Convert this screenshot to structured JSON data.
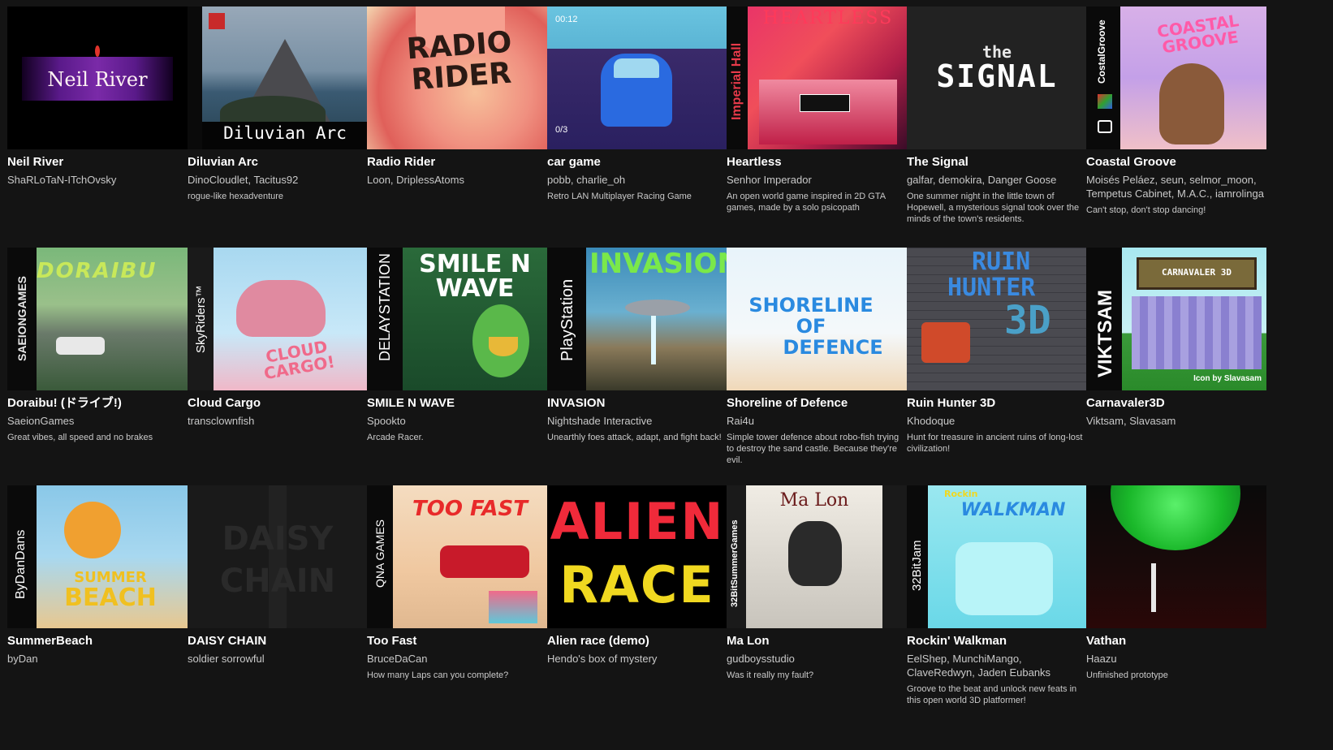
{
  "games": [
    {
      "title": "Neil River",
      "authors": [
        "ShaRLoTaN-ITchOvsky"
      ],
      "description": "",
      "cover_text": "Neil River"
    },
    {
      "title": "Diluvian Arc",
      "authors": [
        "DinoCloudlet",
        "Tacitus92"
      ],
      "description": "rogue-like hexadventure",
      "cover_text": "Diluvian Arc"
    },
    {
      "title": "Radio Rider",
      "authors": [
        "Loon",
        "DriplessAtoms"
      ],
      "description": "",
      "cover_text": "RADIO RIDER"
    },
    {
      "title": "car game",
      "authors": [
        "pobb",
        "charlie_oh"
      ],
      "description": "Retro LAN Multiplayer Racing Game",
      "video_time": "00:12",
      "video_count": "0/3"
    },
    {
      "title": "Heartless",
      "authors": [
        "Senhor Imperador"
      ],
      "description": "An open world game inspired in 2D GTA games, made by a solo psicopath",
      "cover_text": "HEARTLESS",
      "spine_text": "Imperial Hall"
    },
    {
      "title": "The Signal",
      "authors": [
        "galfar",
        "demokira",
        "Danger Goose"
      ],
      "description": "One summer night in the little town of Hopewell, a mysterious signal took over the minds of the town's residents.",
      "cover_text_small": "the",
      "cover_text": "SIGNAL"
    },
    {
      "title": "Coastal Groove",
      "authors": [
        "Moisés Peláez",
        "seun",
        "selmor_moon",
        "Tempetus Cabinet",
        "M.A.C.",
        "iamrolinga"
      ],
      "description": "Can't stop, don't stop dancing!",
      "cover_text": "COASTAL GROOVE",
      "spine_text": "CostalGroove"
    },
    {
      "title": "Doraibu! (ドライブ!)",
      "authors": [
        "SaeionGames"
      ],
      "description": "Great vibes, all speed and no brakes",
      "cover_text": "DORAIBU",
      "spine_text": "SAEIONGAMES"
    },
    {
      "title": "Cloud Cargo",
      "authors": [
        "transclownfish"
      ],
      "description": "",
      "cover_text": "CLOUD CARGO!",
      "spine_text": "SkyRiders™"
    },
    {
      "title": "SMILE N WAVE",
      "authors": [
        "Spookto"
      ],
      "description": "Arcade Racer.",
      "cover_text": "SMILE N WAVE",
      "spine_text": "DELAYSTATION"
    },
    {
      "title": "INVASION",
      "authors": [
        "Nightshade Interactive"
      ],
      "description": "Unearthly foes attack, adapt, and fight back!",
      "cover_text": "INVASION",
      "spine_text": "PlayStation"
    },
    {
      "title": "Shoreline of Defence",
      "authors": [
        "Rai4u"
      ],
      "description": "Simple tower defence about robo-fish trying to destroy the sand castle. Because they're evil.",
      "cover_lines": [
        "SHORELINE",
        "OF",
        "DEFENCE"
      ]
    },
    {
      "title": "Ruin Hunter 3D",
      "authors": [
        "Khodoque"
      ],
      "description": "Hunt for treasure in ancient ruins of long-lost civilization!",
      "cover_lines": [
        "RUIN",
        "HUNTER",
        "3D"
      ]
    },
    {
      "title": "Carnavaler3D",
      "authors": [
        "Viktsam",
        "Slavasam"
      ],
      "description": "",
      "cover_text": "CARNAVALER 3D",
      "spine_text": "VIKTSAM",
      "credit": "Icon by Slavasam"
    },
    {
      "title": "SummerBeach",
      "authors": [
        "byDan"
      ],
      "description": "",
      "cover_lines": [
        "SUMMER",
        "BEACH"
      ],
      "spine_text": "ByDanDans"
    },
    {
      "title": "DAISY CHAIN",
      "authors": [
        "soldier sorrowful"
      ],
      "description": "",
      "cover_lines": [
        "DAISY",
        "CHAIN"
      ]
    },
    {
      "title": "Too Fast",
      "authors": [
        "BruceDaCan"
      ],
      "description": "How many Laps can you complete?",
      "cover_text": "TOO FAST",
      "spine_text": "QNA GAMES"
    },
    {
      "title": "Alien race (demo)",
      "authors": [
        "Hendo's box of mystery"
      ],
      "description": "",
      "cover_lines": [
        "ALIEN",
        "RACE"
      ]
    },
    {
      "title": "Ma Lon",
      "authors": [
        "gudboysstudio"
      ],
      "description": "Was it really my fault?",
      "cover_text": "Ma Lon",
      "spine_text": "32BitSummerGames"
    },
    {
      "title": "Rockin' Walkman",
      "authors": [
        "EelShep",
        "MunchiMango",
        "ClaveRedwyn",
        "Jaden Eubanks"
      ],
      "description": "Groove to the beat and unlock new feats in this open world 3D platformer!",
      "cover_text": "WALKMAN",
      "cover_text_small": "Rockin",
      "spine_text": "32BitJam"
    },
    {
      "title": "Vathan",
      "authors": [
        "Haazu"
      ],
      "description": "Unfinished prototype"
    }
  ],
  "colors": {
    "background": "#141414",
    "title": "#ffffff",
    "meta": "#c9c9c9"
  }
}
